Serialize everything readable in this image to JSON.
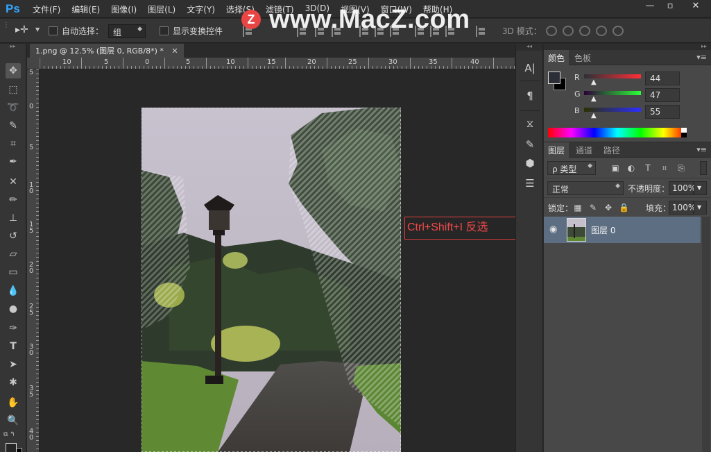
{
  "app": {
    "logo": "Ps",
    "menu": [
      "文件(F)",
      "编辑(E)",
      "图像(I)",
      "图层(L)",
      "文字(Y)",
      "选择(S)",
      "滤镜(T)",
      "3D(D)",
      "视图(V)",
      "窗口(W)",
      "帮助(H)"
    ],
    "window_controls": {
      "minimize": "—",
      "maximize": "▫",
      "close": "✕"
    },
    "watermark": {
      "badge": "Z",
      "text": "www.MacZ.com"
    }
  },
  "options_bar": {
    "auto_select_label": "自动选择：",
    "auto_select_value": "组",
    "show_transform_label": "显示变换控件",
    "mode_3d_label": "3D 模式："
  },
  "document": {
    "tab_title": "1.png @ 12.5% (图层 0, RGB/8*) *",
    "tab_close": "✕",
    "ruler_top_labels": [
      "10",
      "5",
      "0",
      "5",
      "10",
      "15",
      "20",
      "25",
      "30",
      "35",
      "40"
    ],
    "ruler_left_labels": [
      "5",
      "0",
      "5",
      "1 0",
      "1 5",
      "2 0",
      "2 5",
      "3 0",
      "3 5",
      "4 0"
    ]
  },
  "annotation": {
    "text": "Ctrl+Shift+I 反选"
  },
  "color_panel": {
    "tabs": [
      "颜色",
      "色板"
    ],
    "active_tab": 0,
    "foreground": "#2c2f37",
    "background": "#000000",
    "channels": [
      {
        "label": "R",
        "value": "44",
        "gradient": [
          "#2c2f37",
          "#ff2f37"
        ]
      },
      {
        "label": "G",
        "value": "47",
        "gradient": [
          "#2c0037",
          "#2cff37"
        ]
      },
      {
        "label": "B",
        "value": "55",
        "gradient": [
          "#2c2f00",
          "#2c2fff"
        ]
      }
    ]
  },
  "layers_panel": {
    "tabs": [
      "图层",
      "通道",
      "路径"
    ],
    "active_tab": 0,
    "filter_label": "ρ 类型",
    "blend_mode": "正常",
    "opacity_label": "不透明度：",
    "opacity_value": "100%",
    "lock_label": "锁定：",
    "fill_label": "填充：",
    "fill_value": "100%",
    "layers": [
      {
        "name": "图层 0",
        "visible": true
      }
    ]
  },
  "tools": [
    "move-tool",
    "marquee-tool",
    "lasso-tool",
    "quick-select-tool",
    "crop-tool",
    "eyedropper-tool",
    "healing-brush-tool",
    "brush-tool",
    "clone-stamp-tool",
    "history-brush-tool",
    "eraser-tool",
    "gradient-tool",
    "blur-tool",
    "dodge-tool",
    "pen-tool",
    "type-tool",
    "path-select-tool",
    "shape-tool",
    "hand-tool",
    "zoom-tool"
  ]
}
